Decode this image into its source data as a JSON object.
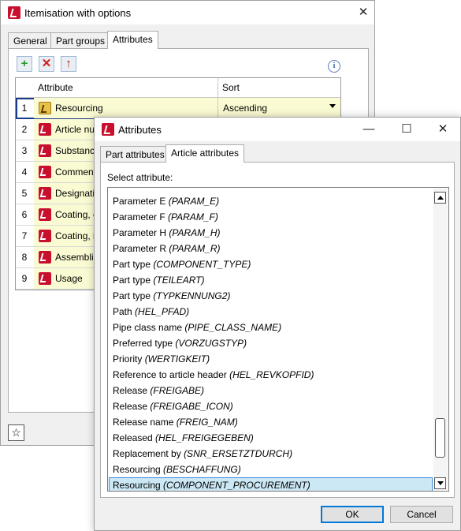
{
  "main_window": {
    "title": "Itemisation with options",
    "tabs": [
      {
        "label": "General",
        "active": false
      },
      {
        "label": "Part groups",
        "active": false
      },
      {
        "label": "Attributes",
        "active": true
      }
    ],
    "toolbar": {
      "add_icon": "add-green-plus",
      "delete_icon": "delete-red-x",
      "move_up_icon": "move-up-arrow",
      "info_icon": "info-circle"
    },
    "grid": {
      "columns": [
        "Attribute",
        "Sort"
      ],
      "rows": [
        {
          "num": "1",
          "attribute": "Resourcing",
          "sort": "Ascending",
          "icon": "resourcing-icon"
        },
        {
          "num": "2",
          "attribute": "Article nur",
          "sort": "",
          "icon": "attribute-icon"
        },
        {
          "num": "3",
          "attribute": "Substance",
          "sort": "",
          "icon": "attribute-icon"
        },
        {
          "num": "4",
          "attribute": "Comment",
          "sort": "",
          "icon": "attribute-icon"
        },
        {
          "num": "5",
          "attribute": "Designatio",
          "sort": "",
          "icon": "attribute-icon"
        },
        {
          "num": "6",
          "attribute": "Coating, e",
          "sort": "",
          "icon": "attribute-icon"
        },
        {
          "num": "7",
          "attribute": "Coating, ir",
          "sort": "",
          "icon": "attribute-icon"
        },
        {
          "num": "8",
          "attribute": "Assemblin",
          "sort": "",
          "icon": "attribute-icon"
        },
        {
          "num": "9",
          "attribute": "Usage",
          "sort": "",
          "icon": "attribute-icon"
        }
      ]
    },
    "favorite_icon": "star-outline"
  },
  "dialog": {
    "title": "Attributes",
    "tabs": [
      {
        "label": "Part attributes",
        "active": false
      },
      {
        "label": "Article attributes",
        "active": true
      }
    ],
    "select_label": "Select attribute:",
    "items": [
      {
        "name": "Parameter E",
        "code": "(PARAM_E)"
      },
      {
        "name": "Parameter F",
        "code": "(PARAM_F)"
      },
      {
        "name": "Parameter H",
        "code": "(PARAM_H)"
      },
      {
        "name": "Parameter R",
        "code": "(PARAM_R)"
      },
      {
        "name": "Part type",
        "code": "(COMPONENT_TYPE)"
      },
      {
        "name": "Part type",
        "code": "(TEILEART)"
      },
      {
        "name": "Part type",
        "code": "(TYPKENNUNG2)"
      },
      {
        "name": "Path",
        "code": "(HEL_PFAD)"
      },
      {
        "name": "Pipe class name",
        "code": "(PIPE_CLASS_NAME)"
      },
      {
        "name": "Preferred type",
        "code": "(VORZUGSTYP)"
      },
      {
        "name": "Priority",
        "code": "(WERTIGKEIT)"
      },
      {
        "name": "Reference to article header",
        "code": "(HEL_REVKOPFID)"
      },
      {
        "name": "Release",
        "code": "(FREIGABE)"
      },
      {
        "name": "Release",
        "code": "(FREIGABE_ICON)"
      },
      {
        "name": "Release name",
        "code": "(FREIG_NAM)"
      },
      {
        "name": "Released",
        "code": "(HEL_FREIGEGEBEN)"
      },
      {
        "name": "Replacement by",
        "code": "(SNR_ERSETZTDURCH)"
      },
      {
        "name": "Resourcing",
        "code": "(BESCHAFFUNG)"
      },
      {
        "name": "Resourcing",
        "code": "(COMPONENT_PROCUREMENT)",
        "selected": true
      }
    ],
    "scroll_position": 0.93,
    "ok_label": "OK",
    "cancel_label": "Cancel"
  }
}
